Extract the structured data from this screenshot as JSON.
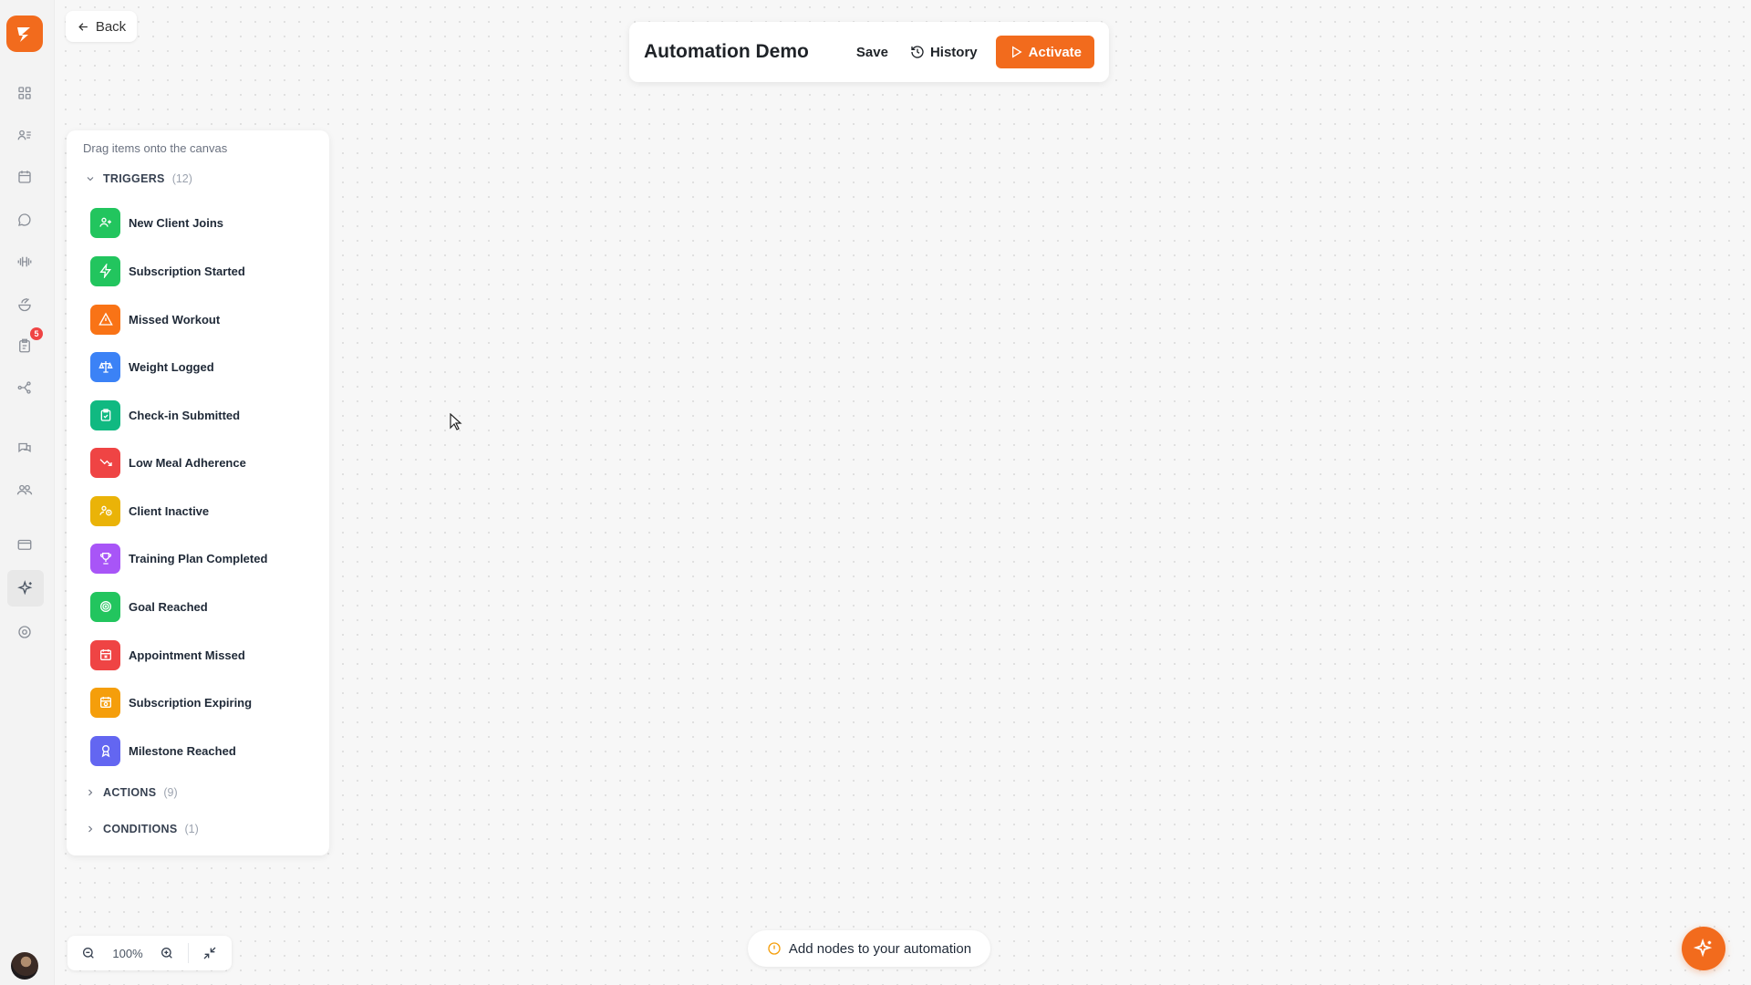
{
  "back": {
    "label": "Back"
  },
  "toolbar": {
    "title": "Automation Demo",
    "save_label": "Save",
    "history_label": "History",
    "activate_label": "Activate"
  },
  "rail": {
    "badge_count": "5",
    "items": [
      "dashboard-icon",
      "clients-icon",
      "calendar-icon",
      "messages-icon",
      "workouts-icon",
      "nutrition-icon",
      "tasks-icon",
      "integrations-icon",
      "community-icon",
      "team-icon",
      "billing-icon",
      "automations-icon",
      "settings-icon"
    ]
  },
  "palette": {
    "hint": "Drag items onto the canvas",
    "sections": [
      {
        "label": "TRIGGERS",
        "count": "(12)",
        "expanded": true
      },
      {
        "label": "ACTIONS",
        "count": "(9)",
        "expanded": false
      },
      {
        "label": "CONDITIONS",
        "count": "(1)",
        "expanded": false
      }
    ],
    "triggers": [
      {
        "label": "New Client Joins",
        "color": "#22c55e",
        "icon": "user-plus-icon"
      },
      {
        "label": "Subscription Started",
        "color": "#22c55e",
        "icon": "bolt-icon"
      },
      {
        "label": "Missed Workout",
        "color": "#f97316",
        "icon": "warning-icon"
      },
      {
        "label": "Weight Logged",
        "color": "#3b82f6",
        "icon": "scale-icon"
      },
      {
        "label": "Check-in Submitted",
        "color": "#10b981",
        "icon": "clipboard-check-icon"
      },
      {
        "label": "Low Meal Adherence",
        "color": "#ef4444",
        "icon": "trend-down-icon"
      },
      {
        "label": "Client Inactive",
        "color": "#eab308",
        "icon": "user-clock-icon"
      },
      {
        "label": "Training Plan Completed",
        "color": "#a855f7",
        "icon": "trophy-icon"
      },
      {
        "label": "Goal Reached",
        "color": "#22c55e",
        "icon": "target-icon"
      },
      {
        "label": "Appointment Missed",
        "color": "#ef4444",
        "icon": "calendar-x-icon"
      },
      {
        "label": "Subscription Expiring",
        "color": "#f59e0b",
        "icon": "calendar-clock-icon"
      },
      {
        "label": "Milestone Reached",
        "color": "#6366f1",
        "icon": "award-icon"
      }
    ]
  },
  "zoom": {
    "level": "100%"
  },
  "status": {
    "message": "Add nodes to your automation"
  },
  "colors": {
    "accent": "#f26b1d",
    "canvas": "#f7f7f7"
  }
}
